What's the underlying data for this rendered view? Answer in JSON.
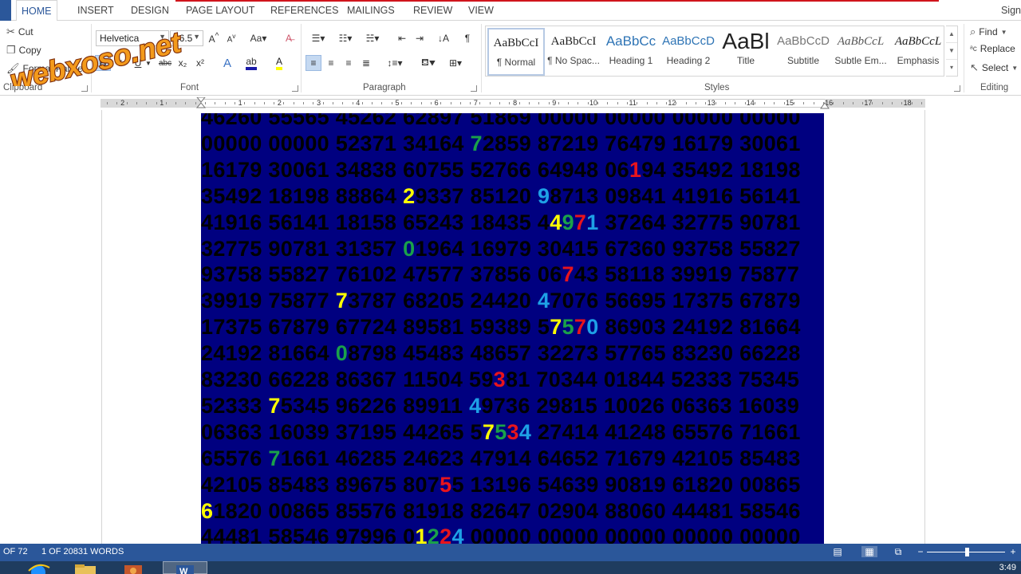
{
  "tabs": [
    {
      "id": "home",
      "label": "HOME"
    },
    {
      "id": "insert",
      "label": "INSERT"
    },
    {
      "id": "design",
      "label": "DESIGN"
    },
    {
      "id": "page_layout",
      "label": "PAGE LAYOUT"
    },
    {
      "id": "references",
      "label": "REFERENCES"
    },
    {
      "id": "mailings",
      "label": "MAILINGS"
    },
    {
      "id": "review",
      "label": "REVIEW"
    },
    {
      "id": "view",
      "label": "VIEW"
    }
  ],
  "sign_in": "Sign",
  "clipboard": {
    "cut": "Cut",
    "copy": "Copy",
    "format_painter": "Format Painter",
    "group_label": "Clipboard"
  },
  "font": {
    "name": "Helvetica",
    "size": "16.5",
    "group_label": "Font",
    "bold": "B",
    "italic": "I",
    "underline": "U",
    "strike": "abc",
    "subscript": "x₂",
    "superscript": "x²"
  },
  "paragraph": {
    "group_label": "Paragraph"
  },
  "styles": {
    "group_label": "Styles",
    "items": [
      {
        "preview": "AaBbCcI",
        "name": "¶ Normal"
      },
      {
        "preview": "AaBbCcI",
        "name": "¶ No Spac..."
      },
      {
        "preview": "AaBbCc",
        "name": "Heading 1"
      },
      {
        "preview": "AaBbCcD",
        "name": "Heading 2"
      },
      {
        "preview": "AaBl",
        "name": "Title"
      },
      {
        "preview": "AaBbCcD",
        "name": "Subtitle"
      },
      {
        "preview": "AaBbCcL",
        "name": "Subtle Em..."
      },
      {
        "preview": "AaBbCcL",
        "name": "Emphasis"
      }
    ]
  },
  "editing": {
    "find": "Find",
    "replace": "Replace",
    "select": "Select",
    "group_label": "Editing"
  },
  "ruler": {
    "left_numbers": [
      "2",
      "1"
    ],
    "right_numbers": [
      "1",
      "2",
      "3",
      "4",
      "5",
      "6",
      "7",
      "8",
      "9",
      "10",
      "11",
      "12",
      "13",
      "14",
      "15",
      "16",
      "17",
      "18"
    ]
  },
  "document": {
    "rows": [
      "46260 55565 45262 62897 51869 00000 00000 00000 00000",
      "00000 00000 52371 34164 72859 87219 76479 16179 30061",
      "16179 30061 34838 60755 52766 64948 06194 35492 18198",
      "35492 18198 88864 29337 85120 98713 09841 41916 56141",
      "41916 56141 18158 65243 18435 44971 37264 32775 90781",
      "32775 90781 31357 01964 16979 30415 67360 93758 55827",
      "93758 55827 76102 47577 37856 06743 58118 39919 75877",
      "39919 75877 73787 68205 24420 47076 56695 17375 67879",
      "17375 67879 67724 89581 59389 57570 86903 24192 81664",
      "24192 81664 08798 45483 48657 32273 57765 83230 66228",
      "83230 66228 86367 11504 59381 70344 01844 52333 75345",
      "52333 75345 96226 89911 49736 29815 10026 06363 16039",
      "06363 16039 37195 44265 57534 27414 41248 65576 71661",
      "65576 71661 46285 24623 47914 64652 71679 42105 85483",
      "42105 85483 89675 80755 13196 54639 90819 61820 00865",
      "61820 00865 85576 81918 82647 02904 88060 44481 58546",
      "44481 58546 97996 01224 00000 00000 00000 00000 00000"
    ],
    "highlights": [
      {
        "row": 1,
        "col": 24,
        "color": "green"
      },
      {
        "row": 2,
        "col": 38,
        "color": "red"
      },
      {
        "row": 3,
        "col": 18,
        "color": "yellow"
      },
      {
        "row": 3,
        "col": 30,
        "color": "blue"
      },
      {
        "row": 4,
        "col": 31,
        "color": "yellow"
      },
      {
        "row": 4,
        "col": 32,
        "color": "green"
      },
      {
        "row": 4,
        "col": 33,
        "color": "red"
      },
      {
        "row": 4,
        "col": 34,
        "color": "blue"
      },
      {
        "row": 5,
        "col": 18,
        "color": "green"
      },
      {
        "row": 6,
        "col": 32,
        "color": "red"
      },
      {
        "row": 7,
        "col": 12,
        "color": "yellow"
      },
      {
        "row": 7,
        "col": 30,
        "color": "blue"
      },
      {
        "row": 8,
        "col": 31,
        "color": "yellow"
      },
      {
        "row": 8,
        "col": 32,
        "color": "green"
      },
      {
        "row": 8,
        "col": 33,
        "color": "red"
      },
      {
        "row": 8,
        "col": 34,
        "color": "blue"
      },
      {
        "row": 9,
        "col": 12,
        "color": "green"
      },
      {
        "row": 10,
        "col": 26,
        "color": "red"
      },
      {
        "row": 11,
        "col": 6,
        "color": "yellow"
      },
      {
        "row": 11,
        "col": 24,
        "color": "blue"
      },
      {
        "row": 12,
        "col": 25,
        "color": "yellow"
      },
      {
        "row": 12,
        "col": 26,
        "color": "green"
      },
      {
        "row": 12,
        "col": 27,
        "color": "red"
      },
      {
        "row": 12,
        "col": 28,
        "color": "blue"
      },
      {
        "row": 13,
        "col": 6,
        "color": "green"
      },
      {
        "row": 14,
        "col": 21,
        "color": "red"
      },
      {
        "row": 15,
        "col": 0,
        "color": "yellow"
      },
      {
        "row": 16,
        "col": 19,
        "color": "yellow"
      },
      {
        "row": 16,
        "col": 20,
        "color": "green"
      },
      {
        "row": 16,
        "col": 21,
        "color": "red"
      },
      {
        "row": 16,
        "col": 22,
        "color": "blue"
      }
    ]
  },
  "colors": {
    "grid_bg": "#000080",
    "digit": "#000000",
    "yellow": "#ffff00",
    "green": "#1aa14a",
    "red": "#e8141c",
    "blue": "#1ea0e6",
    "accent": "#2b579a"
  },
  "status": {
    "page": "OF 72",
    "words": "1 OF 20831 WORDS"
  },
  "taskbar": {
    "clock": "3:49"
  },
  "watermark": "webxoso.net"
}
